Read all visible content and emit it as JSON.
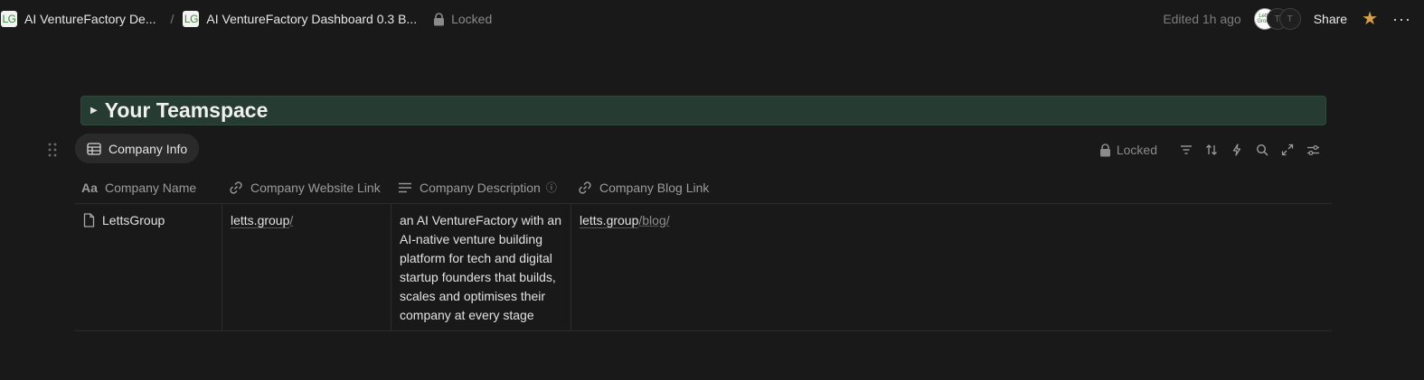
{
  "breadcrumb": {
    "items": [
      {
        "logo": "LG",
        "title": "AI VentureFactory De..."
      },
      {
        "logo": "LG",
        "title": "AI VentureFactory Dashboard 0.3 B..."
      }
    ],
    "separator": "/",
    "locked_label": "Locked"
  },
  "header_right": {
    "edited": "Edited 1h ago",
    "avatars": [
      "Letts Group",
      "T",
      "T"
    ],
    "share_label": "Share",
    "star_color": "#d8a04a",
    "more_label": "···"
  },
  "teamspace": {
    "title": "Your Teamspace",
    "arrow": "▶",
    "background": "#263b31"
  },
  "view": {
    "tab_label": "Company Info",
    "tab_icon": "table-icon",
    "locked_label": "Locked",
    "tools": [
      "filter-icon",
      "sort-icon",
      "lightning-icon",
      "search-icon",
      "expand-icon",
      "settings-sliders-icon"
    ]
  },
  "table": {
    "columns": [
      {
        "label": "Company Name",
        "icon": "title-aa-icon",
        "icon_text": "Aa"
      },
      {
        "label": "Company Website Link",
        "icon": "link-icon"
      },
      {
        "label": "Company Description",
        "icon": "text-lines-icon",
        "info": "ⓘ"
      },
      {
        "label": "Company Blog Link",
        "icon": "link-icon"
      }
    ],
    "rows": [
      {
        "name": "LettsGroup",
        "website_main": "letts.group",
        "website_path": "/",
        "description": "an AI VentureFactory with an AI-native venture building platform for tech and digital startup founders that builds, scales and optimises their company at every stage",
        "blog_main": "letts.group",
        "blog_path": "/blog/"
      }
    ]
  }
}
